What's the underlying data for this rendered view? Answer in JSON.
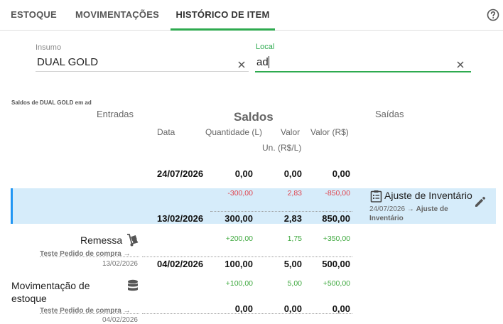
{
  "tabs": [
    {
      "label": "ESTOQUE"
    },
    {
      "label": "MOVIMENTAÇÕES"
    },
    {
      "label": "HISTÓRICO DE ITEM"
    }
  ],
  "active_tab": "HISTÓRICO DE ITEM",
  "filters": {
    "insumo": {
      "label": "Insumo",
      "value": "DUAL GOLD"
    },
    "local": {
      "label": "Local",
      "value": "ad"
    }
  },
  "summary_title": "Saldos de DUAL GOLD em ad",
  "headers": {
    "entradas": "Entradas",
    "saldos": "Saldos",
    "saidas": "Saídas",
    "data": "Data",
    "quantidade": "Quantidade (L)",
    "valor_un": "Valor",
    "valor_un_sub": "Un. (R$/L)",
    "valor_total": "Valor (R$)"
  },
  "rows": [
    {
      "date": "24/07/2026",
      "qty": "0,00",
      "unit": "0,00",
      "total": "0,00"
    },
    {
      "delta_qty": "-300,00",
      "delta_unit": "2,83",
      "delta_total": "-850,00",
      "date": "13/02/2026",
      "qty": "300,00",
      "unit": "2,83",
      "total": "850,00",
      "saida": {
        "title": "Ajuste de Inventário",
        "date": "24/07/2026",
        "arrow": "→",
        "ref": "Ajuste de Inventário"
      }
    },
    {
      "delta_qty": "+200,00",
      "delta_unit": "1,75",
      "delta_total": "+350,00",
      "date": "04/02/2026",
      "qty": "100,00",
      "unit": "5,00",
      "total": "500,00",
      "entrada": {
        "title": "Remessa",
        "ref": "Teste Pedido de compra",
        "arrow": "→",
        "date": "13/02/2026"
      }
    },
    {
      "delta_qty": "+100,00",
      "delta_unit": "5,00",
      "delta_total": "+500,00",
      "date": "",
      "qty": "0,00",
      "unit": "0,00",
      "total": "0,00",
      "entrada": {
        "title_line1": "Movimentação de",
        "title_line2": "estoque",
        "ref": "Teste Pedido de compra",
        "arrow": "→",
        "date": "04/02/2026"
      }
    }
  ],
  "colors": {
    "accent": "#2eaa4f",
    "highlight": "#d6ecfa",
    "negative": "#e0454f",
    "positive": "#3ea83e"
  },
  "icons": [
    "help-icon",
    "clear-icon",
    "clipboard-icon",
    "edit-icon",
    "dolly-icon",
    "database-icon"
  ]
}
